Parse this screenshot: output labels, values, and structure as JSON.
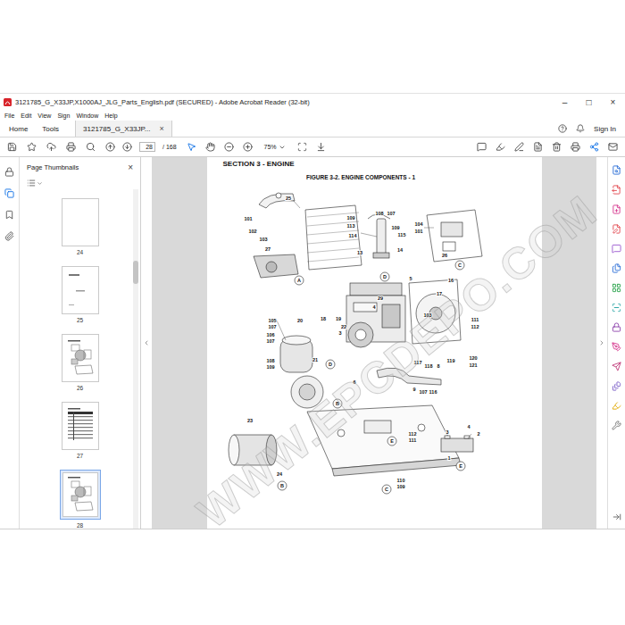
{
  "window": {
    "title": "3121785_G_X33JP,X1000AJ_JLG_Parts_English.pdf (SECURED) - Adobe Acrobat Reader (32-bit)",
    "controls": [
      "–",
      "□",
      "×"
    ]
  },
  "menu": [
    "File",
    "Edit",
    "View",
    "Sign",
    "Window",
    "Help"
  ],
  "tabs": [
    {
      "label": "Home",
      "selected": false,
      "close": ""
    },
    {
      "label": "Tools",
      "selected": false,
      "close": ""
    },
    {
      "label": "3121785_G_X33JP...",
      "selected": true,
      "close": "×"
    }
  ],
  "account": {
    "sign_in": "Sign In"
  },
  "toolbar": {
    "page": "28",
    "page_count": "/ 168",
    "zoom": "75%"
  },
  "left_rail": [
    {
      "selected": false
    },
    {
      "selected": true
    },
    {
      "selected": false
    },
    {
      "selected": false
    }
  ],
  "sidebar": {
    "title": "Page Thumbnails",
    "close": "×",
    "thumbnails": [
      {
        "label": "24",
        "kind": "blank",
        "selected": false
      },
      {
        "label": "25",
        "kind": "text",
        "selected": false
      },
      {
        "label": "26",
        "kind": "drawing",
        "selected": false
      },
      {
        "label": "27",
        "kind": "table",
        "selected": false
      },
      {
        "label": "28",
        "kind": "drawing",
        "selected": true
      }
    ]
  },
  "document": {
    "section": "SECTION 3 - ENGINE",
    "figure": "FIGURE 3-2. ENGINE COMPONENTS - 1",
    "callouts": [
      {
        "label": "25",
        "kind": "number"
      },
      {
        "label": "101",
        "kind": "number"
      },
      {
        "label": "102",
        "kind": "number"
      },
      {
        "label": "103",
        "kind": "number"
      },
      {
        "label": "27",
        "kind": "number"
      },
      {
        "label": "A",
        "kind": "circle"
      },
      {
        "label": "109",
        "kind": "number"
      },
      {
        "label": "113",
        "kind": "number"
      },
      {
        "label": "114",
        "kind": "number"
      },
      {
        "label": "108",
        "kind": "number"
      },
      {
        "label": "107",
        "kind": "number"
      },
      {
        "label": "109",
        "kind": "number"
      },
      {
        "label": "115",
        "kind": "number"
      },
      {
        "label": "14",
        "kind": "number"
      },
      {
        "label": "13",
        "kind": "number"
      },
      {
        "label": "D",
        "kind": "circle"
      },
      {
        "label": "104",
        "kind": "number"
      },
      {
        "label": "101",
        "kind": "number"
      },
      {
        "label": "26",
        "kind": "number"
      },
      {
        "label": "C",
        "kind": "circle"
      },
      {
        "label": "29",
        "kind": "number"
      },
      {
        "label": "4",
        "kind": "number"
      },
      {
        "label": "5",
        "kind": "number"
      },
      {
        "label": "16",
        "kind": "number"
      },
      {
        "label": "17",
        "kind": "number"
      },
      {
        "label": "103",
        "kind": "number"
      },
      {
        "label": "111",
        "kind": "number"
      },
      {
        "label": "112",
        "kind": "number"
      },
      {
        "label": "105",
        "kind": "number"
      },
      {
        "label": "107",
        "kind": "number"
      },
      {
        "label": "20",
        "kind": "number"
      },
      {
        "label": "18",
        "kind": "number"
      },
      {
        "label": "19",
        "kind": "number"
      },
      {
        "label": "22",
        "kind": "number"
      },
      {
        "label": "3",
        "kind": "number"
      },
      {
        "label": "106",
        "kind": "number"
      },
      {
        "label": "107",
        "kind": "number"
      },
      {
        "label": "108",
        "kind": "number"
      },
      {
        "label": "109",
        "kind": "number"
      },
      {
        "label": "21",
        "kind": "number"
      },
      {
        "label": "D",
        "kind": "circle"
      },
      {
        "label": "6",
        "kind": "number"
      },
      {
        "label": "B",
        "kind": "circle"
      },
      {
        "label": "117",
        "kind": "number"
      },
      {
        "label": "118",
        "kind": "number"
      },
      {
        "label": "8",
        "kind": "number"
      },
      {
        "label": "119",
        "kind": "number"
      },
      {
        "label": "120",
        "kind": "number"
      },
      {
        "label": "121",
        "kind": "number"
      },
      {
        "label": "9",
        "kind": "number"
      },
      {
        "label": "107",
        "kind": "number"
      },
      {
        "label": "116",
        "kind": "number"
      },
      {
        "label": "23",
        "kind": "number"
      },
      {
        "label": "24",
        "kind": "number"
      },
      {
        "label": "B",
        "kind": "circle"
      },
      {
        "label": "4",
        "kind": "number"
      },
      {
        "label": "2",
        "kind": "number"
      },
      {
        "label": "3",
        "kind": "number"
      },
      {
        "label": "E",
        "kind": "circle"
      },
      {
        "label": "112",
        "kind": "number"
      },
      {
        "label": "111",
        "kind": "number"
      },
      {
        "label": "1",
        "kind": "number"
      },
      {
        "label": "E",
        "kind": "circle"
      },
      {
        "label": "110",
        "kind": "number"
      },
      {
        "label": "109",
        "kind": "number"
      },
      {
        "label": "C",
        "kind": "circle"
      }
    ]
  },
  "right_tools": [
    {
      "color": "#2b6dd6"
    },
    {
      "color": "#e34850"
    },
    {
      "color": "#d63a8f"
    },
    {
      "color": "#e34850"
    },
    {
      "color": "#9b59d0"
    },
    {
      "color": "#2b6dd6"
    },
    {
      "color": "#2da44e"
    },
    {
      "color": "#1fa1a1"
    },
    {
      "color": "#8e44ad"
    },
    {
      "color": "#d63a8f"
    },
    {
      "color": "#c2407d"
    },
    {
      "color": "#7a5cc7"
    },
    {
      "color": "#e0a800"
    },
    {
      "color": "#6e6e6e"
    }
  ],
  "watermark": "WWW.EPCDEPO.COM"
}
